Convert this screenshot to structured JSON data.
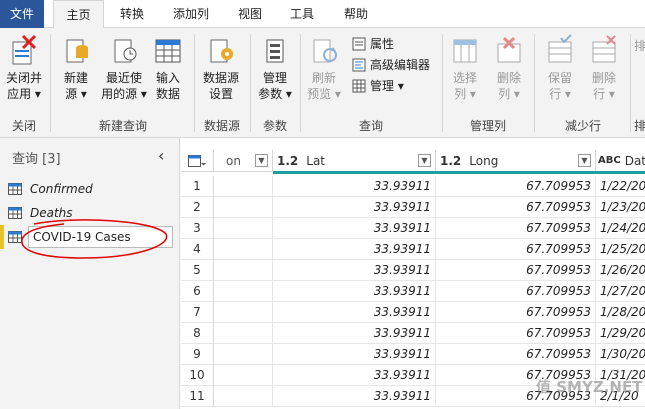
{
  "tabs": [
    "文件",
    "主页",
    "转换",
    "添加列",
    "视图",
    "工具",
    "帮助"
  ],
  "ribbon": {
    "close_apply": [
      "关闭并",
      "应用 ▾"
    ],
    "new_source": [
      "新建",
      "源 ▾"
    ],
    "recent_sources": [
      "最近使",
      "用的源 ▾"
    ],
    "enter_data": [
      "输入",
      "数据"
    ],
    "datasource_settings": [
      "数据源",
      "设置"
    ],
    "manage_params": [
      "管理",
      "参数 ▾"
    ],
    "refresh_preview": [
      "刷新",
      "预览 ▾"
    ],
    "properties": "属性",
    "advanced_editor": "高级编辑器",
    "manage": "管理 ▾",
    "choose_columns": [
      "选择",
      "列 ▾"
    ],
    "remove_columns": [
      "删除",
      "列 ▾"
    ],
    "keep_rows": [
      "保留",
      "行 ▾"
    ],
    "remove_rows": [
      "删除",
      "行 ▾"
    ],
    "edge_text": "排",
    "groups": {
      "close": "关闭",
      "new_query": "新建查询",
      "datasource": "数据源",
      "params": "参数",
      "query": "查询",
      "manage_cols": "管理列",
      "reduce_rows": "减少行",
      "sort": "排"
    }
  },
  "queries": {
    "title": "查询 [3]",
    "collapse_icon": "‹",
    "items": [
      "Confirmed",
      "Deaths"
    ],
    "editing_value": "COVID-19 Cases"
  },
  "grid": {
    "columns": [
      {
        "type": "",
        "name": "on"
      },
      {
        "type": "1.2",
        "name": "Lat"
      },
      {
        "type": "1.2",
        "name": "Long"
      },
      {
        "type": "ABC",
        "name": "Date"
      }
    ],
    "rows": [
      {
        "n": "1",
        "lat": "33.93911",
        "long": "67.709953",
        "date": "1/22/20"
      },
      {
        "n": "2",
        "lat": "33.93911",
        "long": "67.709953",
        "date": "1/23/20"
      },
      {
        "n": "3",
        "lat": "33.93911",
        "long": "67.709953",
        "date": "1/24/20"
      },
      {
        "n": "4",
        "lat": "33.93911",
        "long": "67.709953",
        "date": "1/25/20"
      },
      {
        "n": "5",
        "lat": "33.93911",
        "long": "67.709953",
        "date": "1/26/20"
      },
      {
        "n": "6",
        "lat": "33.93911",
        "long": "67.709953",
        "date": "1/27/20"
      },
      {
        "n": "7",
        "lat": "33.93911",
        "long": "67.709953",
        "date": "1/28/20"
      },
      {
        "n": "8",
        "lat": "33.93911",
        "long": "67.709953",
        "date": "1/29/20"
      },
      {
        "n": "9",
        "lat": "33.93911",
        "long": "67.709953",
        "date": "1/30/20"
      },
      {
        "n": "10",
        "lat": "33.93911",
        "long": "67.709953",
        "date": "1/31/20"
      },
      {
        "n": "11",
        "lat": "33.93911",
        "long": "67.709953",
        "date": "2/1/20"
      }
    ]
  },
  "watermark": "值 SMYZ.NET",
  "colors": {
    "file_tab": "#2b579a",
    "accent_teal": "#1aa0a0",
    "annotation_red": "#e00000"
  }
}
